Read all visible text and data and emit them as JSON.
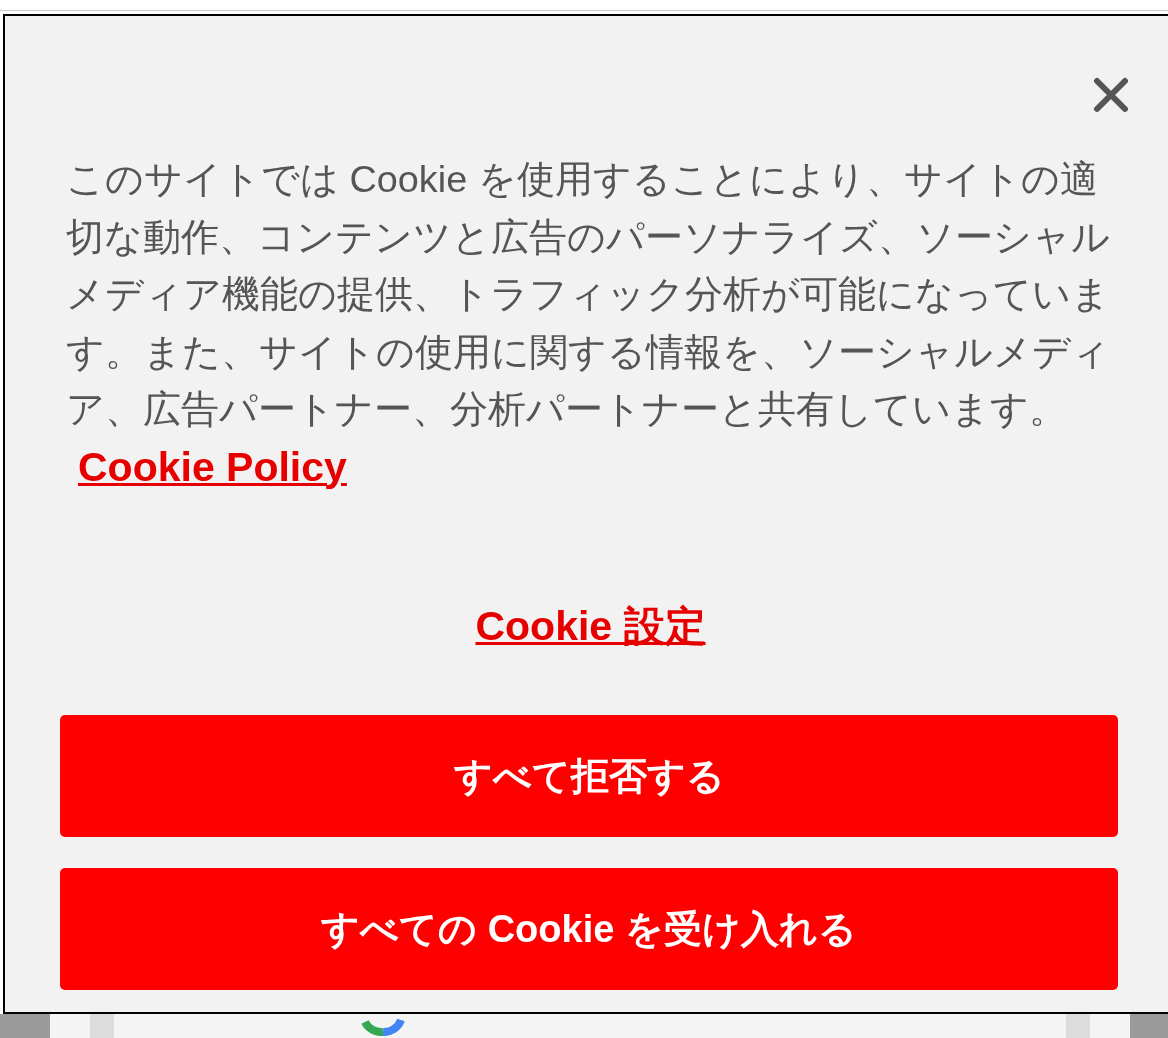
{
  "cookie_banner": {
    "message": "このサイトでは Cookie を使用することにより、サイトの適切な動作、コンテンツと広告のパーソナライズ、ソーシャルメディア機能の提供、トラフィック分析が可能になっています。また、サイトの使用に関する情報を、ソーシャルメディア、広告パートナー、分析パートナーと共有しています。",
    "policy_link": "Cookie Policy",
    "settings_link": "Cookie 設定",
    "buttons": [
      "すべて拒否する",
      "すべての Cookie を受け入れる"
    ]
  }
}
